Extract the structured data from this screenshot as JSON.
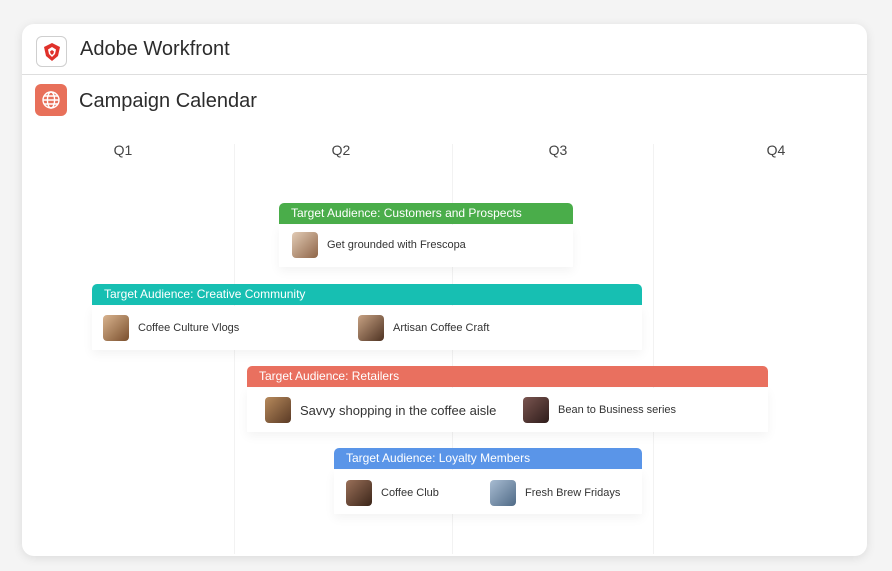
{
  "app": {
    "title": "Adobe Workfront",
    "logo_icon": "workfront-logo-icon"
  },
  "page": {
    "title": "Campaign Calendar",
    "icon": "globe-icon",
    "icon_color": "#e8705a"
  },
  "quarters": [
    "Q1",
    "Q2",
    "Q3",
    "Q4"
  ],
  "audiences": [
    {
      "label": "Target Audience: Customers and Prospects",
      "color": "#4aad4a",
      "campaigns": [
        {
          "label": "Get grounded with Frescopa",
          "thumb_color": "#b08a6c"
        }
      ]
    },
    {
      "label": "Target Audience: Creative Community",
      "color": "#17bfb2",
      "campaigns": [
        {
          "label": "Coffee Culture Vlogs",
          "thumb_color": "#9b6e45"
        },
        {
          "label": "Artisan Coffee Craft",
          "thumb_color": "#6f4b34"
        }
      ]
    },
    {
      "label": "Target Audience: Retailers",
      "color": "#e9705f",
      "campaigns": [
        {
          "label": "Savvy shopping in the coffee aisle",
          "thumb_color": "#7a5236"
        },
        {
          "label": "Bean to Business series",
          "thumb_color": "#4a2f2a"
        }
      ]
    },
    {
      "label": "Target Audience: Loyalty Members",
      "color": "#5a95e8",
      "campaigns": [
        {
          "label": "Coffee Club",
          "thumb_color": "#5b3d2c"
        },
        {
          "label": "Fresh Brew Fridays",
          "thumb_color": "#6e88a6"
        }
      ]
    }
  ]
}
